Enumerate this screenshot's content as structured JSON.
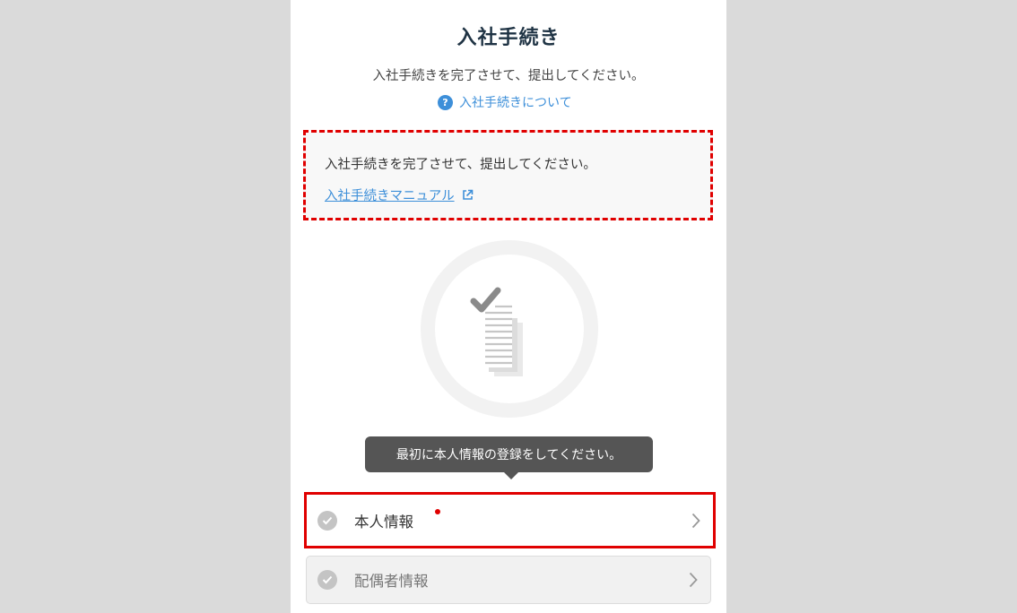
{
  "header": {
    "title": "入社手続き",
    "subtitle": "入社手続きを完了させて、提出してください。",
    "help_link": "入社手続きについて",
    "help_icon": "question-circle-icon"
  },
  "notice": {
    "text": "入社手続きを完了させて、提出してください。",
    "manual_link": "入社手続きマニュアル",
    "link_icon": "external-link-icon"
  },
  "illustration": {
    "icon": "checked-documents-icon"
  },
  "tooltip": {
    "text": "最初に本人情報の登録をしてください。"
  },
  "steps": [
    {
      "label": "本人情報",
      "required": true,
      "status_icon": "check-circle-icon"
    },
    {
      "label": "配偶者情報",
      "required": false,
      "status_icon": "check-circle-icon"
    }
  ],
  "colors": {
    "accent": "#3d8fd9",
    "highlight": "#e00000",
    "title": "#1f3344"
  }
}
